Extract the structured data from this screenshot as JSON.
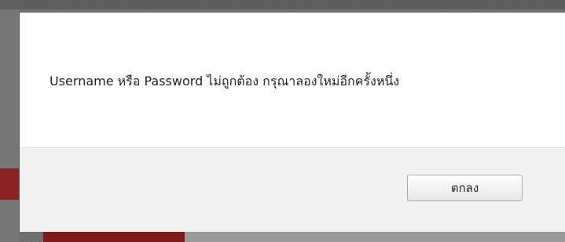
{
  "dialog": {
    "message": "Username หรือ Password ไม่ถูกต้อง กรุณาลองใหม่อีกครั้งหนึ่ง",
    "ok_label": "ตกลง"
  },
  "colors": {
    "dialog_bg": "#ffffff",
    "footer_bg": "#f1f1f1",
    "overlay": "#6b6b6b",
    "accent_red": "#8b2323"
  }
}
